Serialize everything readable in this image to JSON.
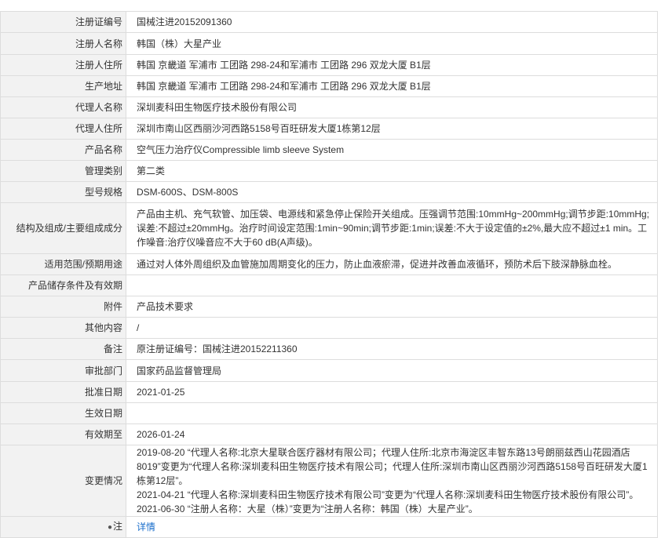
{
  "rows": [
    {
      "label": "注册证编号",
      "value": "国械注进20152091360"
    },
    {
      "label": "注册人名称",
      "value": "韩国（株）大星产业"
    },
    {
      "label": "注册人住所",
      "value": "韩国 京畿道 军浦市 工团路 298-24和军浦市 工团路 296 双龙大厦 B1层"
    },
    {
      "label": "生产地址",
      "value": "韩国 京畿道 军浦市 工团路 298-24和军浦市 工团路 296 双龙大厦 B1层"
    },
    {
      "label": "代理人名称",
      "value": "深圳麦科田生物医疗技术股份有限公司"
    },
    {
      "label": "代理人住所",
      "value": "深圳市南山区西丽沙河西路5158号百旺研发大厦1栋第12层"
    },
    {
      "label": "产品名称",
      "value": "空气压力治疗仪Compressible limb sleeve System"
    },
    {
      "label": "管理类别",
      "value": "第二类"
    },
    {
      "label": "型号规格",
      "value": "DSM-600S、DSM-800S"
    },
    {
      "label": "结构及组成/主要组成成分",
      "value": "产品由主机、充气软管、加压袋、电源线和紧急停止保险开关组成。压强调节范围:10mmHg~200mmHg;调节步距:10mmHg;误差:不超过±20mmHg。治疗时间设定范围:1min~90min;调节步距:1min;误差:不大于设定值的±2%,最大应不超过±1 min。工作噪音:治疗仪噪音应不大于60 dB(A声级)。"
    },
    {
      "label": "适用范围/预期用途",
      "value": "通过对人体外周组织及血管施加周期变化的压力，防止血液瘀滞，促进并改善血液循环，预防术后下肢深静脉血栓。"
    },
    {
      "label": "产品储存条件及有效期",
      "value": ""
    },
    {
      "label": "附件",
      "value": "产品技术要求"
    },
    {
      "label": "其他内容",
      "value": "/"
    },
    {
      "label": "备注",
      "value": "原注册证编号：国械注进20152211360"
    },
    {
      "label": "审批部门",
      "value": "国家药品监督管理局"
    },
    {
      "label": "批准日期",
      "value": "2021-01-25"
    },
    {
      "label": "生效日期",
      "value": ""
    },
    {
      "label": "有效期至",
      "value": "2026-01-24"
    }
  ],
  "changes": {
    "label": "变更情况",
    "lines": [
      "2019-08-20 “代理人名称:北京大星联合医疗器材有限公司；代理人住所:北京市海淀区丰智东路13号朗丽兹西山花园酒店8019”变更为“代理人名称:深圳麦科田生物医疗技术有限公司；代理人住所:深圳市南山区西丽沙河西路5158号百旺研发大厦1栋第12层”。",
      "2021-04-21 “代理人名称:深圳麦科田生物医疗技术有限公司”变更为“代理人名称:深圳麦科田生物医疗技术股份有限公司”。",
      "2021-06-30 “注册人名称：大星（株）”变更为“注册人名称：韩国（株）大星产业”。"
    ]
  },
  "note": {
    "icon": "pin-icon",
    "label": "注",
    "link_text": "详情"
  }
}
